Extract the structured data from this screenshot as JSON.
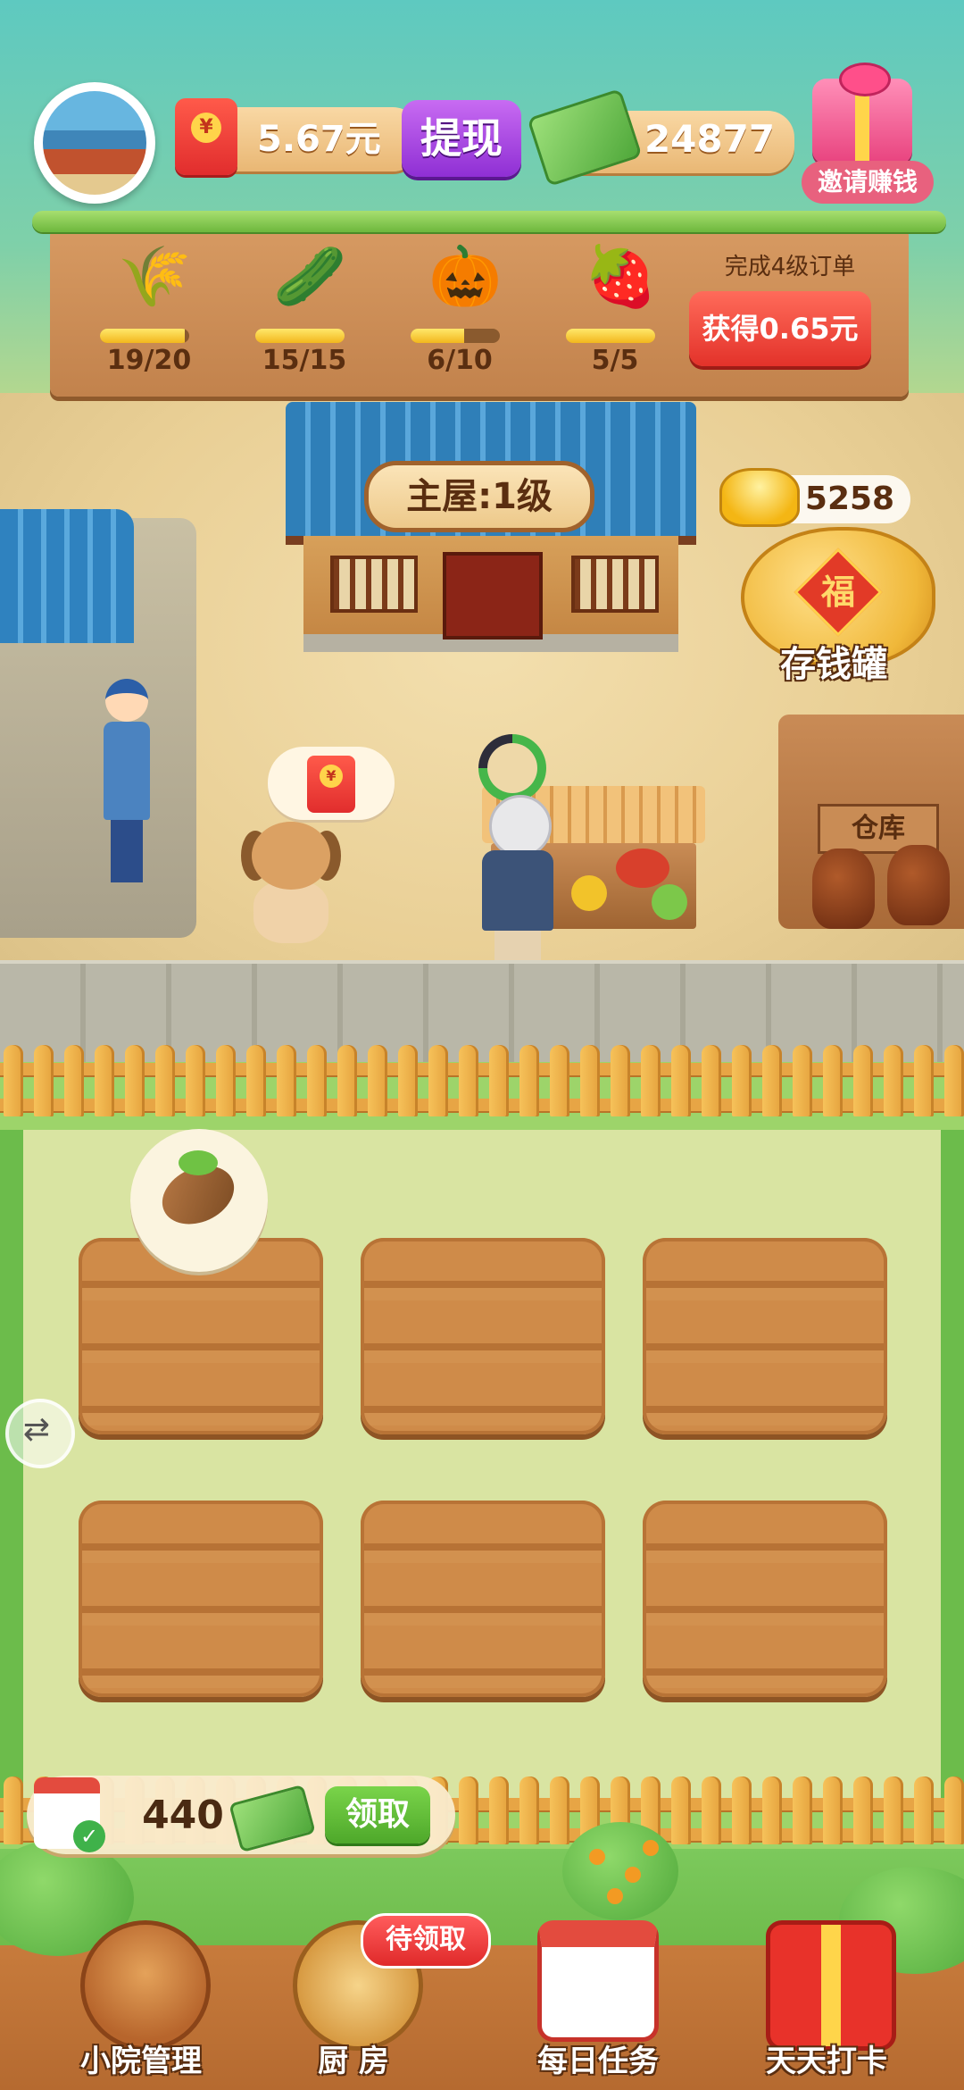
{
  "header": {
    "cash_amount": "5.67元",
    "cash_icon": "red-envelope-icon",
    "withdraw_label": "提现",
    "money_amount": "24877",
    "money_icon": "cash-stack-icon",
    "invite_label": "邀请赚钱",
    "invite_icon": "gift-box-icon"
  },
  "orders": {
    "crops": [
      {
        "name": "wheat",
        "icon": "🌾",
        "count": "19/20",
        "progress": 0.95
      },
      {
        "name": "cucumber",
        "icon": "🥒",
        "count": "15/15",
        "progress": 1.0
      },
      {
        "name": "pumpkin",
        "icon": "🎃",
        "count": "6/10",
        "progress": 0.6
      },
      {
        "name": "strawberry",
        "icon": "🍓",
        "count": "5/5",
        "progress": 1.0
      }
    ],
    "condition": "完成4级订单",
    "reward_button": "获得0.65元"
  },
  "scene": {
    "main_house_sign": "主屋:1级",
    "gold_amount": "5258",
    "piggy_bank_label": "存钱罐",
    "piggy_bank_char": "福",
    "warehouse_label": "仓库",
    "dog_bubble_icon": "red-envelope-icon",
    "player_progress": 0.75,
    "side_button_icon": "swap-icon",
    "side_button_glyph": "⇄"
  },
  "field": {
    "plots": 6,
    "seed_bubble_icon": "seed-icon"
  },
  "claim": {
    "amount": "440",
    "button_label": "领取",
    "check_glyph": "✓"
  },
  "nav": {
    "items": [
      {
        "label": "小院管理",
        "icon": "barn-icon"
      },
      {
        "label": "厨  房",
        "icon": "steamer-icon"
      },
      {
        "label": "每日任务",
        "icon": "calendar-icon"
      },
      {
        "label": "天天打卡",
        "icon": "gift-box-icon"
      }
    ],
    "kitchen_badge": "待领取"
  },
  "colors": {
    "accent_red": "#e3322a",
    "withdraw_purple": "#8f2fd4",
    "claim_green": "#4ea82a",
    "wood": "#c2824c"
  }
}
